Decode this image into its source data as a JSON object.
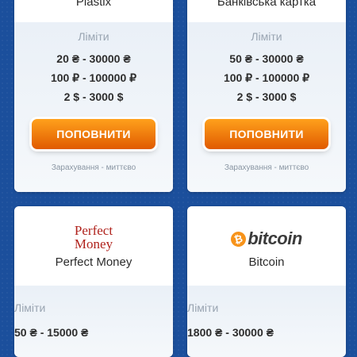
{
  "cards": [
    {
      "name": "Plastix",
      "limits_title": "Ліміти",
      "limits": [
        "20 ₴ - 30000 ₴",
        "100 ₽ - 100000 ₽",
        "2 $ - 3000 $"
      ],
      "button_label": "ПОПОВНИТИ",
      "note": "Зарахування - миттєво"
    },
    {
      "name": "Банківська картка",
      "limits_title": "Ліміти",
      "limits": [
        "50 ₴ - 30000 ₴",
        "100 ₽ - 100000 ₽",
        "2 $ - 3000 $"
      ],
      "button_label": "ПОПОВНИТИ",
      "note": "Зарахування - миттєво"
    },
    {
      "name": "Perfect Money",
      "logo_text": [
        "Perfect",
        "Money"
      ],
      "limits_title": "Ліміти",
      "limits": [
        "50 ₴ - 15000 ₴"
      ]
    },
    {
      "name": "Bitcoin",
      "logo_symbol": "₿",
      "logo_text": "bitcoin",
      "limits_title": "Ліміти",
      "limits": [
        "1800 ₴ - 30000 ₴"
      ]
    }
  ],
  "colors": {
    "background": "#1b4f9c",
    "button_top": "#ffa11c",
    "button_bottom": "#e05a00",
    "perfect_money_red": "#b0221c",
    "bitcoin_orange": "#f7931a"
  },
  "icons": {
    "perfect_money": "perfect-money-logo",
    "bitcoin": "bitcoin-logo"
  }
}
